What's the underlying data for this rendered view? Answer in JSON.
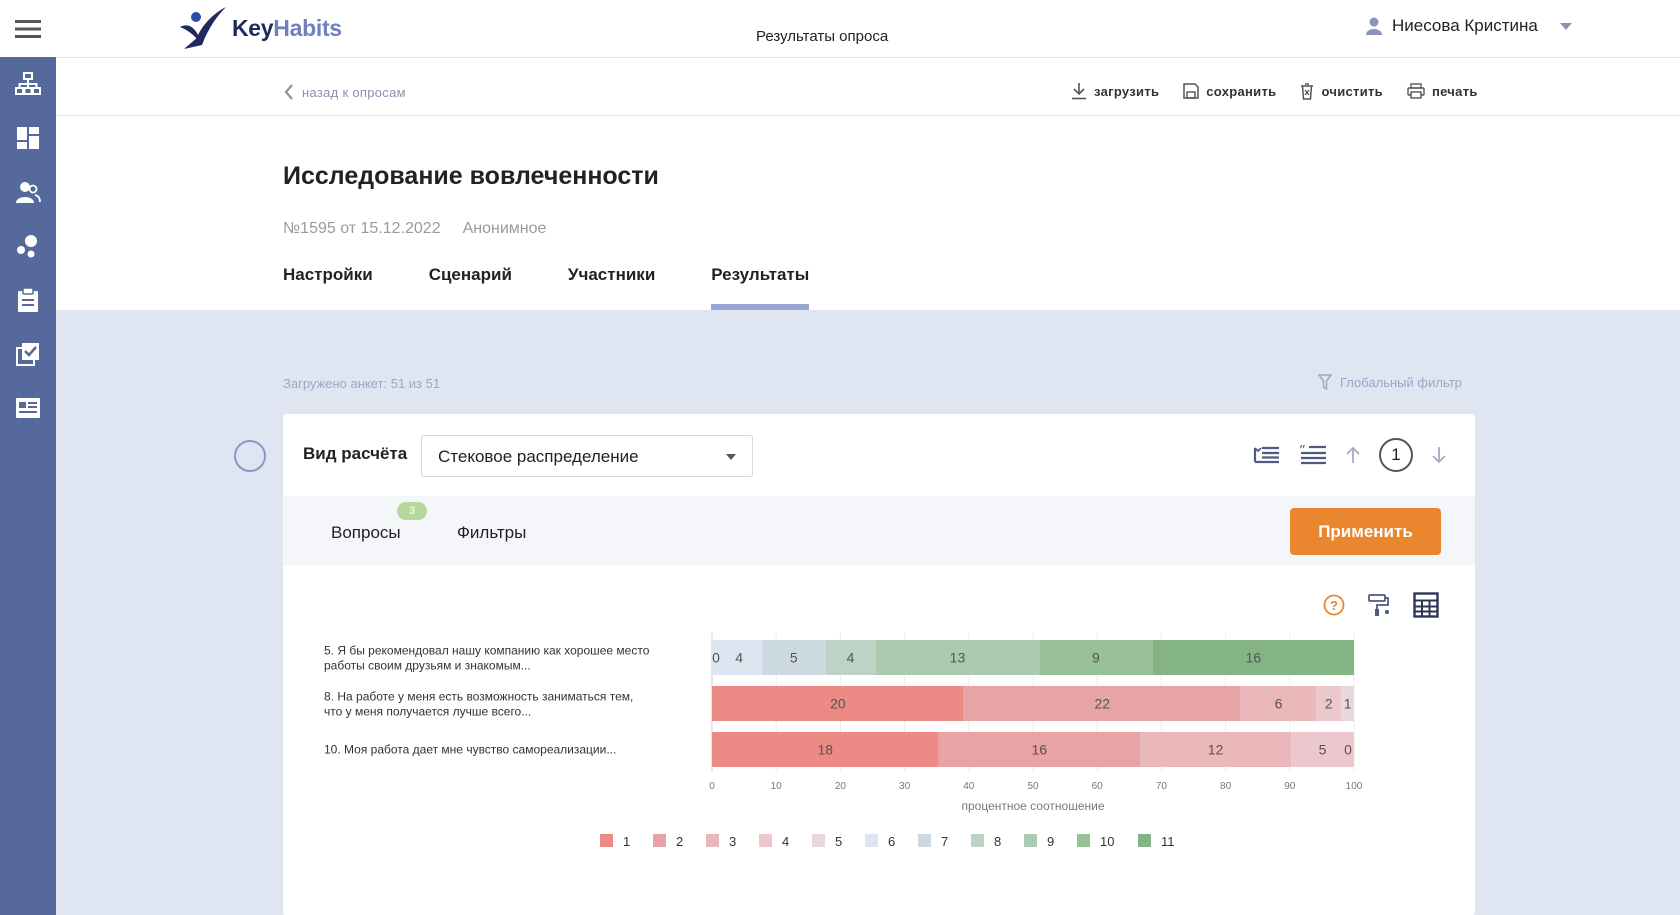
{
  "app": {
    "logo_key": "Key",
    "logo_habits": "Habits",
    "header_title": "Результаты опроса",
    "user_name": "Ниесова Кристина"
  },
  "sidebar": {
    "items": [
      {
        "icon": "org-chart-icon"
      },
      {
        "icon": "dashboard-icon"
      },
      {
        "icon": "users-icon"
      },
      {
        "icon": "bubbles-icon"
      },
      {
        "icon": "clipboard-icon"
      },
      {
        "icon": "checklist-icon"
      },
      {
        "icon": "news-icon"
      }
    ]
  },
  "toolbar": {
    "back_label": "назад к опросам",
    "download_label": "загрузить",
    "save_label": "сохранить",
    "clear_label": "очистить",
    "print_label": "печать"
  },
  "survey": {
    "title": "Исследование вовлеченности",
    "number": "№1595 от 15.12.2022",
    "type": "Анонимное",
    "tabs": [
      {
        "label": "Настройки"
      },
      {
        "label": "Сценарий"
      },
      {
        "label": "Участники"
      },
      {
        "label": "Результаты"
      }
    ],
    "active_tab": "Результаты"
  },
  "results": {
    "loaded_text": "Загружено анкет: 51 из 51",
    "global_filter_label": "Глобальный фильтр",
    "calc_label": "Вид расчёта",
    "calc_value": "Стековое распределение",
    "page": "1",
    "questions_label": "Вопросы",
    "questions_count": "3",
    "filters_label": "Фильтры",
    "apply_label": "Применить"
  },
  "chart_data": {
    "type": "bar",
    "orientation": "horizontal",
    "stacked": true,
    "categories": [
      [
        "5. Я бы рекомендовал нашу компанию как хорошее место",
        "работы своим друзьям и знакомым..."
      ],
      [
        "8. На работе у меня есть возможность заниматься тем,",
        "что у меня получается лучше всего..."
      ],
      [
        "10. Моя работа дает мне чувство самореализации..."
      ]
    ],
    "xlabel": "процентное соотношение",
    "xlim": [
      0,
      100
    ],
    "xticks": [
      "0",
      "10",
      "20",
      "30",
      "40",
      "50",
      "60",
      "70",
      "80",
      "90",
      "100"
    ],
    "legend_position": "bottom",
    "series": [
      {
        "name": "1",
        "color": "#ec8a86",
        "counts": [
          0,
          20,
          18
        ]
      },
      {
        "name": "2",
        "color": "#e8a3a4",
        "counts": [
          0,
          22,
          16
        ]
      },
      {
        "name": "3",
        "color": "#eab7bb",
        "counts": [
          0,
          6,
          12
        ]
      },
      {
        "name": "4",
        "color": "#ecc8ce",
        "counts": [
          0,
          2,
          5
        ]
      },
      {
        "name": "5",
        "color": "#e9d7df",
        "counts": [
          0,
          1,
          0
        ]
      },
      {
        "name": "6",
        "color": "#dde5f1",
        "counts": [
          4,
          0,
          0
        ]
      },
      {
        "name": "7",
        "color": "#cdd9e1",
        "counts": [
          5,
          0,
          0
        ]
      },
      {
        "name": "8",
        "color": "#bdd3c6",
        "counts": [
          4,
          0,
          0
        ]
      },
      {
        "name": "9",
        "color": "#abcab0",
        "counts": [
          13,
          0,
          0
        ]
      },
      {
        "name": "10",
        "color": "#98c198",
        "counts": [
          9,
          0,
          0
        ]
      },
      {
        "name": "11",
        "color": "#84b386",
        "counts": [
          16,
          0,
          0
        ]
      }
    ],
    "bar_labels": [
      [
        "0",
        "4",
        "5",
        "4",
        "13",
        "9",
        "16"
      ],
      [
        "20",
        "22",
        "6",
        "2",
        "1"
      ],
      [
        "18",
        "16",
        "12",
        "5",
        "0"
      ]
    ]
  }
}
